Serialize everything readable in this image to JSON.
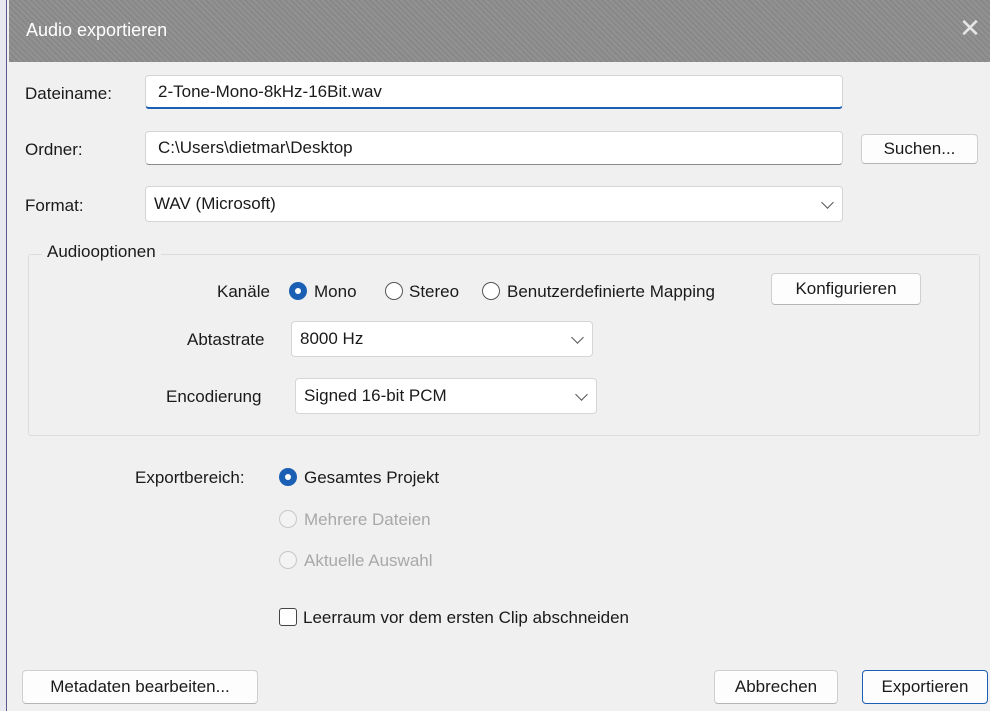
{
  "window": {
    "title": "Audio exportieren"
  },
  "icons": {
    "close": "close-icon",
    "chevron": "chevron-down-icon"
  },
  "colors": {
    "accent": "#1a5fb4",
    "titlebar": "#8c8c8c"
  },
  "file": {
    "filename_label": "Dateiname:",
    "filename_value": "2-Tone-Mono-8kHz-16Bit.wav",
    "folder_label": "Ordner:",
    "folder_value": "C:\\Users\\dietmar\\Desktop",
    "browse_button": "Suchen...",
    "format_label": "Format:",
    "format_value": "WAV (Microsoft)"
  },
  "audio_options": {
    "title": "Audiooptionen",
    "channels_label": "Kanäle",
    "channels": [
      {
        "label": "Mono",
        "selected": true
      },
      {
        "label": "Stereo",
        "selected": false
      },
      {
        "label": "Benutzerdefinierte Mapping",
        "selected": false
      }
    ],
    "configure_button": "Konfigurieren",
    "samplerate_label": "Abtastrate",
    "samplerate_value": "8000 Hz",
    "encoding_label": "Encodierung",
    "encoding_value": "Signed 16-bit PCM"
  },
  "export_range": {
    "label": "Exportbereich:",
    "options": [
      {
        "label": "Gesamtes Projekt",
        "selected": true,
        "enabled": true
      },
      {
        "label": "Mehrere Dateien",
        "selected": false,
        "enabled": false
      },
      {
        "label": "Aktuelle Auswahl",
        "selected": false,
        "enabled": false
      }
    ]
  },
  "trim": {
    "label": "Leerraum vor dem ersten Clip abschneiden",
    "checked": false
  },
  "footer": {
    "metadata_button": "Metadaten bearbeiten...",
    "cancel_button": "Abbrechen",
    "export_button": "Exportieren"
  }
}
